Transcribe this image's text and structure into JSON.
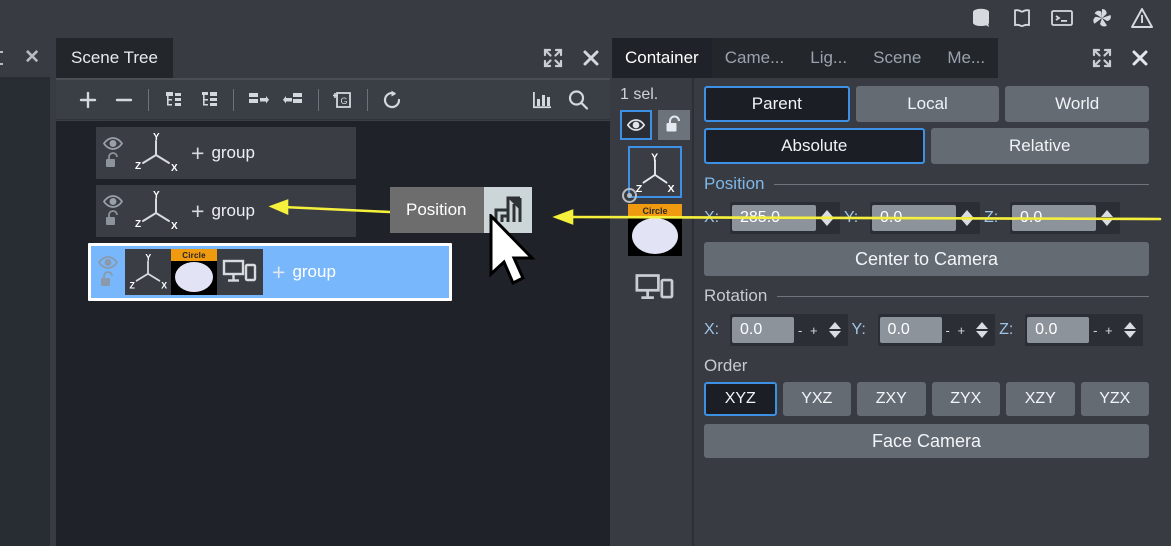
{
  "topbar": {
    "icons": [
      {
        "name": "database-icon",
        "label": "Database"
      },
      {
        "name": "book-icon",
        "label": "Library"
      },
      {
        "name": "terminal-icon",
        "label": "Console"
      },
      {
        "name": "pinwheel-icon",
        "label": "Plugins"
      },
      {
        "name": "warning-triangle-icon",
        "label": "Warnings"
      }
    ]
  },
  "left_stub": {
    "close_label": "✕"
  },
  "scene_tree": {
    "tab_label": "Scene Tree",
    "maximize_label": "⤡",
    "close_label": "✕",
    "toolbar": [
      {
        "name": "add-node-button",
        "glyph": "+"
      },
      {
        "name": "remove-node-button",
        "glyph": "−"
      },
      {
        "name": "expand-tree-button",
        "glyph": "tree-expand"
      },
      {
        "name": "collapse-tree-button",
        "glyph": "tree-collapse"
      },
      {
        "name": "outdent-node-button",
        "glyph": "outdent"
      },
      {
        "name": "indent-node-button",
        "glyph": "indent"
      },
      {
        "name": "add-group-button",
        "glyph": "group-add"
      },
      {
        "name": "refresh-button",
        "glyph": "refresh"
      },
      {
        "name": "statistics-button",
        "glyph": "bar-chart"
      },
      {
        "name": "search-button",
        "glyph": "search"
      }
    ],
    "rows": [
      {
        "label": "group",
        "plus": "+",
        "selected": false,
        "thumbs": [
          "axes"
        ]
      },
      {
        "label": "group",
        "plus": "+",
        "selected": false,
        "thumbs": [
          "axes"
        ]
      },
      {
        "label": "group",
        "plus": "+",
        "selected": true,
        "thumbs": [
          "axes",
          "circle",
          "screen"
        ],
        "circle_caption": "Circle"
      }
    ]
  },
  "properties": {
    "tabs": [
      {
        "label": "Container",
        "active": true
      },
      {
        "label": "Came...",
        "active": false
      },
      {
        "label": "Lig...",
        "active": false
      },
      {
        "label": "Scene",
        "active": false
      },
      {
        "label": "Me...",
        "active": false
      }
    ],
    "maximize_label": "⤡",
    "close_label": "✕",
    "selection_count": "1 sel.",
    "side": {
      "visibility_toggle": "eye-icon",
      "lock_toggle": "unlock-icon",
      "thumbs": [
        {
          "name": "axes-thumbnail",
          "selected": true
        },
        {
          "name": "circle-thumbnail",
          "caption": "Circle",
          "selected": false
        },
        {
          "name": "screen-thumbnail",
          "selected": false
        }
      ]
    },
    "space_buttons": [
      {
        "label": "Parent",
        "active": true
      },
      {
        "label": "Local",
        "active": false
      },
      {
        "label": "World",
        "active": false
      }
    ],
    "mode_buttons": [
      {
        "label": "Absolute",
        "active": true
      },
      {
        "label": "Relative",
        "active": false
      }
    ],
    "position": {
      "title": "Position",
      "fields": [
        {
          "axis": "X:",
          "value": "285.0"
        },
        {
          "axis": "Y:",
          "value": "0.0"
        },
        {
          "axis": "Z:",
          "value": "0.0"
        }
      ],
      "action_label": "Center to Camera"
    },
    "rotation": {
      "title": "Rotation",
      "fields": [
        {
          "axis": "X:",
          "value": "0.0",
          "minus": "-",
          "plus": "+"
        },
        {
          "axis": "Y:",
          "value": "0.0",
          "minus": "-",
          "plus": "+"
        },
        {
          "axis": "Z:",
          "value": "0.0",
          "minus": "-",
          "plus": "+"
        }
      ],
      "order_label": "Order",
      "order_options": [
        {
          "label": "XYZ",
          "active": true
        },
        {
          "label": "YXZ",
          "active": false
        },
        {
          "label": "ZXY",
          "active": false
        },
        {
          "label": "ZYX",
          "active": false
        },
        {
          "label": "XZY",
          "active": false
        },
        {
          "label": "YZX",
          "active": false
        }
      ],
      "action_label": "Face Camera"
    }
  },
  "annotation": {
    "tooltip_label": "Position",
    "tooltip_icon": "layers-icon",
    "arrow_color": "#f5f03c",
    "cursor": "arrow-pointer"
  },
  "colors": {
    "accent_blue": "#3d90e3",
    "selection_blue": "#78b7fb",
    "panel_bg": "#383c42",
    "tree_bg": "#1f2228",
    "button_grey": "#656b73",
    "orange_caption": "#f09a10",
    "annotation_yellow": "#f5f03c"
  }
}
